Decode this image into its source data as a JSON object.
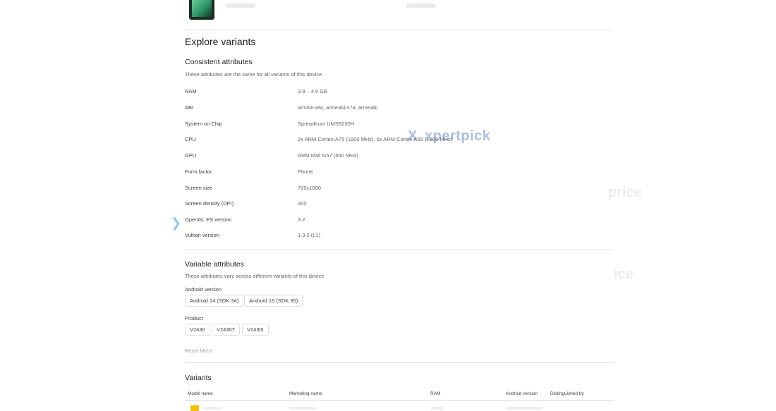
{
  "header": {
    "phone_image_icon": "phone-thumbnail"
  },
  "explore": {
    "title": "Explore variants"
  },
  "consistent": {
    "title": "Consistent attributes",
    "subtitle": "These attributes are the same for all variants of this device",
    "rows": [
      {
        "key": "RAM",
        "value": "3.9 – 4.0 GB"
      },
      {
        "key": "ABI",
        "value": "arm64-v8a, armeabi-v7a, armeabi"
      },
      {
        "key": "System on Chip",
        "value": "Spreadtrum UMS9230H"
      },
      {
        "key": "CPU",
        "value": "2x ARM Cortex-A75 (1800 MHz), 6x ARM Cortex-A55 (1800 MHz)"
      },
      {
        "key": "GPU",
        "value": "ARM Mali G57 (650 MHz)"
      },
      {
        "key": "Form factor",
        "value": "Phone"
      },
      {
        "key": "Screen size",
        "value": "720x1600"
      },
      {
        "key": "Screen density (DPI)",
        "value": "300"
      },
      {
        "key": "OpenGL ES version",
        "value": "3.2"
      },
      {
        "key": "Vulkan version",
        "value": "1.3.0 (L1)"
      }
    ]
  },
  "variable": {
    "title": "Variable attributes",
    "subtitle": "These attributes vary across different variants of this device",
    "android_label": "Android version",
    "android_chips": [
      "Android 14 (SDK 34)",
      "Android 15 (SDK 35)"
    ],
    "product_label": "Product",
    "product_chips": [
      "V2430",
      "V2430T",
      "V2430I"
    ],
    "reset_label": "Reset filters"
  },
  "variants": {
    "title": "Variants",
    "columns": [
      "Model name",
      "Marketing name",
      "RAM",
      "Android version",
      "Distinguished by"
    ]
  },
  "watermark": {
    "logo": "X",
    "text": "xpertpick",
    "ghost1": "price",
    "ghost2": "ice"
  },
  "nav": {
    "next_icon": "chevron-right-icon",
    "next_glyph": "❯"
  }
}
